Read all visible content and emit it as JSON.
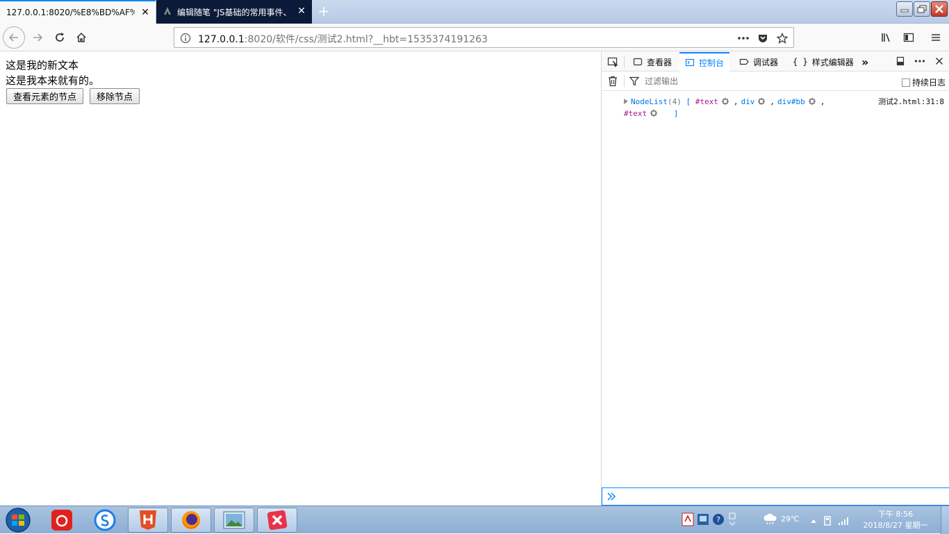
{
  "browser": {
    "tabs": [
      {
        "title": "127.0.0.1:8020/%E8%BD%AF%E4",
        "active": true
      },
      {
        "title": "编辑随笔 \"JS基础的常用事件、",
        "active": false
      }
    ],
    "url": {
      "host": "127.0.0.1",
      "rest": ":8020/软件/css/测试2.html?__hbt=1535374191263"
    }
  },
  "page": {
    "text_line_1": "这是我的新文本",
    "text_line_2": "这是我本来就有的。",
    "button_view_nodes": "查看元素的节点",
    "button_remove_node": "移除节点"
  },
  "devtools": {
    "tabs": [
      {
        "label": "查看器",
        "active": false
      },
      {
        "label": "控制台",
        "active": true
      },
      {
        "label": "调试器",
        "active": false
      },
      {
        "label": "样式编辑器",
        "active": false
      }
    ],
    "filter_placeholder": "过滤输出",
    "persist_logs_label": "持续日志",
    "persist_logs_checked": false,
    "console": {
      "object_name": "NodeList",
      "object_count": "(4)",
      "open_bracket": "[",
      "close_bracket": "]",
      "items": [
        "#text",
        "div",
        "div#bb",
        "#text"
      ],
      "separator": ",",
      "source": "测试2.html:31:8"
    }
  },
  "taskbar": {
    "weather": "29℃",
    "time": "下午 8:56",
    "date": "2018/8/27 星期一"
  },
  "colors": {
    "accent": "#0a84ff",
    "node_text": "#a31a8d",
    "node_tag": "#0074e8"
  }
}
